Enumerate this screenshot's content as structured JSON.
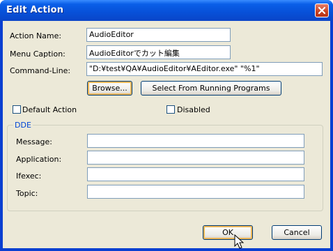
{
  "window": {
    "title": "Edit Action"
  },
  "form": {
    "action_name": {
      "label": "Action Name:",
      "value": "AudioEditor"
    },
    "menu_caption": {
      "label": "Menu Caption:",
      "value": "AudioEditorでカット編集"
    },
    "command_line": {
      "label": "Command-Line:",
      "value": "\"D:¥test¥QA¥AudioEditor¥AEditor.exe\" \"%1\""
    }
  },
  "buttons": {
    "browse": "Browse...",
    "select_running": "Select From Running Programs",
    "ok": "OK",
    "cancel": "Cancel"
  },
  "checkboxes": {
    "default_action": {
      "label": "Default Action",
      "checked": false
    },
    "disabled": {
      "label": "Disabled",
      "checked": false
    }
  },
  "dde": {
    "title": "DDE",
    "message": {
      "label": "Message:",
      "value": ""
    },
    "application": {
      "label": "Application:",
      "value": ""
    },
    "ifexec": {
      "label": "Ifexec:",
      "value": ""
    },
    "topic": {
      "label": "Topic:",
      "value": ""
    }
  }
}
